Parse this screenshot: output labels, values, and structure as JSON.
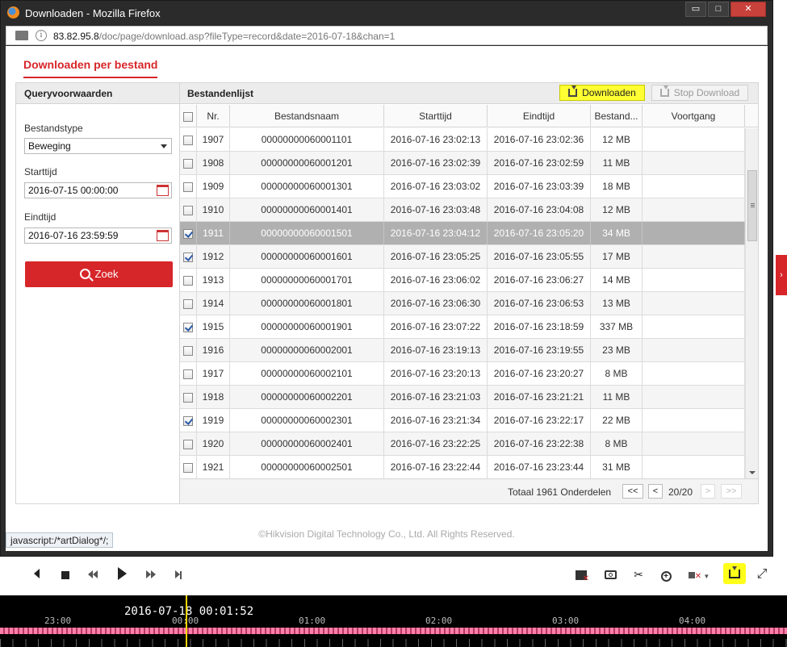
{
  "window": {
    "title": "Downloaden - Mozilla Firefox",
    "controls": [
      "▭",
      "□",
      "✕"
    ],
    "url_host": "83.82.95.8",
    "url_path": "/doc/page/download.asp?fileType=record&date=2016-07-18&chan=1"
  },
  "page": {
    "tab_label": "Downloaden per bestand",
    "copyright": "©Hikvision Digital Technology Co., Ltd. All Rights Reserved.",
    "status_text": "javascript:/*artDialog*/;"
  },
  "query": {
    "title": "Queryvoorwaarden",
    "type_label": "Bestandstype",
    "type_value": "Beweging",
    "start_label": "Starttijd",
    "start_value": "2016-07-15 00:00:00",
    "end_label": "Eindtijd",
    "end_value": "2016-07-16 23:59:59",
    "search_label": "Zoek"
  },
  "files": {
    "title": "Bestandenlijst",
    "download_label": "Downloaden",
    "stop_label": "Stop Download",
    "columns": [
      "Nr.",
      "Bestandsnaam",
      "Starttijd",
      "Eindtijd",
      "Bestand...",
      "Voortgang"
    ],
    "rows": [
      {
        "nr": "1907",
        "name": "00000000060001101",
        "start": "2016-07-16 23:02:13",
        "end": "2016-07-16 23:02:36",
        "size": "12 MB",
        "progress": "",
        "checked": false,
        "selected": false
      },
      {
        "nr": "1908",
        "name": "00000000060001201",
        "start": "2016-07-16 23:02:39",
        "end": "2016-07-16 23:02:59",
        "size": "11 MB",
        "progress": "",
        "checked": false,
        "selected": false
      },
      {
        "nr": "1909",
        "name": "00000000060001301",
        "start": "2016-07-16 23:03:02",
        "end": "2016-07-16 23:03:39",
        "size": "18 MB",
        "progress": "",
        "checked": false,
        "selected": false
      },
      {
        "nr": "1910",
        "name": "00000000060001401",
        "start": "2016-07-16 23:03:48",
        "end": "2016-07-16 23:04:08",
        "size": "12 MB",
        "progress": "",
        "checked": false,
        "selected": false
      },
      {
        "nr": "1911",
        "name": "00000000060001501",
        "start": "2016-07-16 23:04:12",
        "end": "2016-07-16 23:05:20",
        "size": "34 MB",
        "progress": "",
        "checked": true,
        "selected": true
      },
      {
        "nr": "1912",
        "name": "00000000060001601",
        "start": "2016-07-16 23:05:25",
        "end": "2016-07-16 23:05:55",
        "size": "17 MB",
        "progress": "",
        "checked": true,
        "selected": false
      },
      {
        "nr": "1913",
        "name": "00000000060001701",
        "start": "2016-07-16 23:06:02",
        "end": "2016-07-16 23:06:27",
        "size": "14 MB",
        "progress": "",
        "checked": false,
        "selected": false
      },
      {
        "nr": "1914",
        "name": "00000000060001801",
        "start": "2016-07-16 23:06:30",
        "end": "2016-07-16 23:06:53",
        "size": "13 MB",
        "progress": "",
        "checked": false,
        "selected": false
      },
      {
        "nr": "1915",
        "name": "00000000060001901",
        "start": "2016-07-16 23:07:22",
        "end": "2016-07-16 23:18:59",
        "size": "337 MB",
        "progress": "",
        "checked": true,
        "selected": false
      },
      {
        "nr": "1916",
        "name": "00000000060002001",
        "start": "2016-07-16 23:19:13",
        "end": "2016-07-16 23:19:55",
        "size": "23 MB",
        "progress": "",
        "checked": false,
        "selected": false
      },
      {
        "nr": "1917",
        "name": "00000000060002101",
        "start": "2016-07-16 23:20:13",
        "end": "2016-07-16 23:20:27",
        "size": "8 MB",
        "progress": "",
        "checked": false,
        "selected": false
      },
      {
        "nr": "1918",
        "name": "00000000060002201",
        "start": "2016-07-16 23:21:03",
        "end": "2016-07-16 23:21:21",
        "size": "11 MB",
        "progress": "",
        "checked": false,
        "selected": false
      },
      {
        "nr": "1919",
        "name": "00000000060002301",
        "start": "2016-07-16 23:21:34",
        "end": "2016-07-16 23:22:17",
        "size": "22 MB",
        "progress": "",
        "checked": true,
        "selected": false
      },
      {
        "nr": "1920",
        "name": "00000000060002401",
        "start": "2016-07-16 23:22:25",
        "end": "2016-07-16 23:22:38",
        "size": "8 MB",
        "progress": "",
        "checked": false,
        "selected": false
      },
      {
        "nr": "1921",
        "name": "00000000060002501",
        "start": "2016-07-16 23:22:44",
        "end": "2016-07-16 23:23:44",
        "size": "31 MB",
        "progress": "",
        "checked": false,
        "selected": false
      }
    ],
    "total_text": "Totaal 1961 Onderdelen",
    "pager": {
      "first": "<<",
      "prev": "<",
      "page": "20/20",
      "next": ">",
      "last": ">>"
    }
  },
  "player": {
    "timeline_datetime": "2016-07-18 00:01:52",
    "hour_labels": [
      "23:00",
      "00:00",
      "01:00",
      "02:00",
      "03:00",
      "04:00"
    ],
    "highlight_color": "#ffff1a",
    "accent_color": "#d7262a"
  }
}
